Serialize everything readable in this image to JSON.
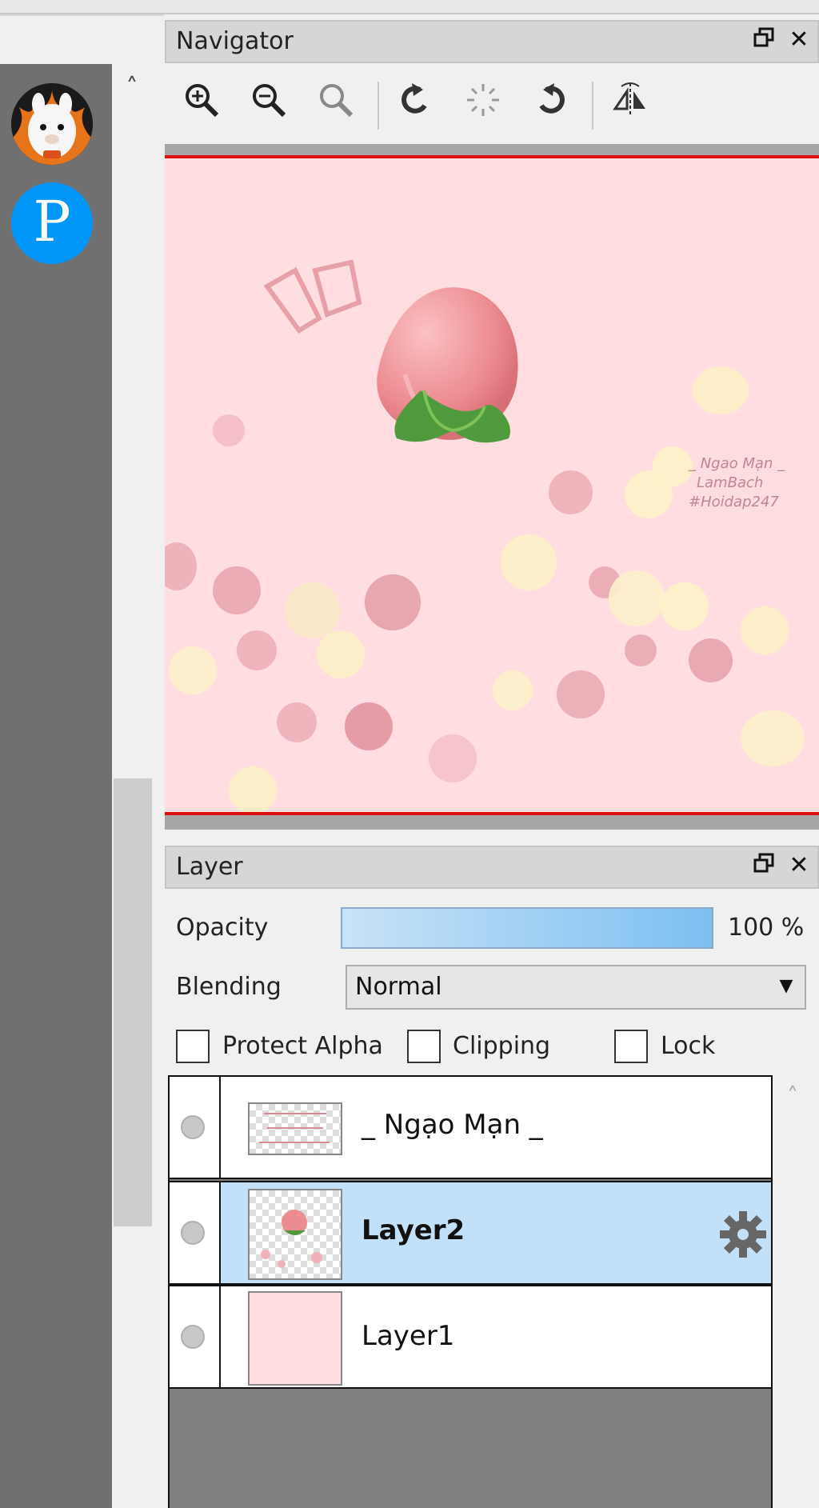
{
  "navigator": {
    "title": "Navigator",
    "tools": [
      "zoom-in-icon",
      "zoom-out-icon",
      "zoom-fit-icon",
      "rotate-left-icon",
      "rotate-reset-icon",
      "rotate-right-icon",
      "flip-horizontal-icon"
    ],
    "watermark_lines": [
      "_ Ngao Mạn _",
      "LamBach",
      "#Hoidap247"
    ]
  },
  "layer_panel": {
    "title": "Layer",
    "opacity_label": "Opacity",
    "opacity_value": "100 %",
    "opacity_fraction": 1.0,
    "blending_label": "Blending",
    "blending_value": "Normal",
    "protect_alpha_label": "Protect Alpha",
    "clipping_label": "Clipping",
    "lock_label": "Lock",
    "layers": [
      {
        "name": "_ Ngạo Mạn _",
        "selected": false
      },
      {
        "name": "Layer2",
        "selected": true
      },
      {
        "name": "Layer1",
        "selected": false
      }
    ]
  },
  "colors": {
    "selected_row": "#c2e0f8",
    "canvas_bg": "#ffdde0",
    "canvas_border": "#e01010",
    "pixiv_blue": "#0096fa"
  }
}
